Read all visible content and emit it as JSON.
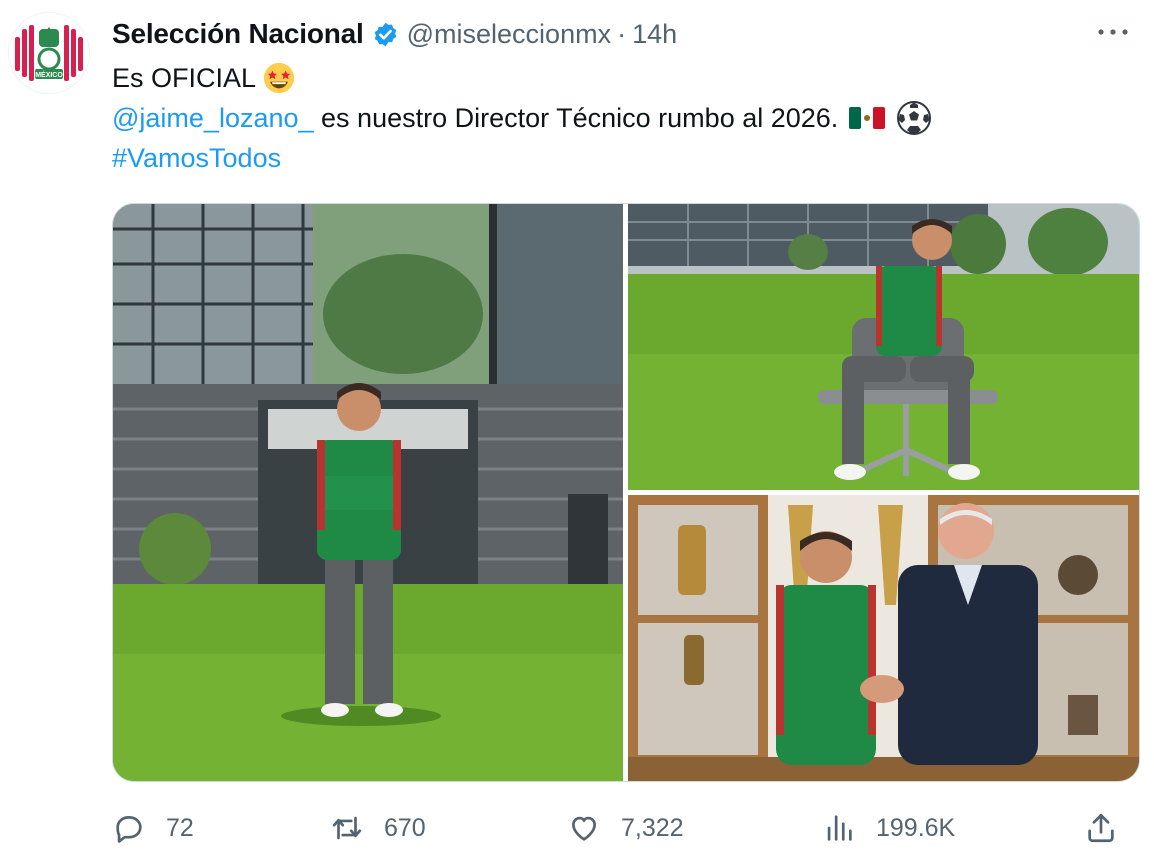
{
  "tweet": {
    "author_name": "Selección Nacional",
    "handle": "@miseleccionmx",
    "separator": "·",
    "time": "14h",
    "line1": "Es OFICIAL",
    "line2_mention": "@jaime_lozano_",
    "line2_text": " es nuestro Director Técnico rumbo al 2026.",
    "line3_hashtag": "#VamosTodos"
  },
  "avatar_text": "MÉXICO",
  "metrics": {
    "replies": "72",
    "reposts": "670",
    "likes": "7,322",
    "views": "199.6K"
  },
  "icons": {
    "verified": "verified-badge-icon",
    "more": "more-icon",
    "reply": "reply-icon",
    "repost": "repost-icon",
    "like": "heart-icon",
    "views": "views-chart-icon",
    "share": "share-icon",
    "emoji_star_struck": "star-struck-emoji-icon",
    "emoji_flag": "mexico-flag-icon",
    "emoji_ball": "soccer-ball-icon"
  },
  "colors": {
    "link": "#1d9bf0",
    "secondary_text": "#536471",
    "verified": "#1d9bf0",
    "jersey_green": "#1e8a46",
    "grass": "#6aa82e"
  }
}
